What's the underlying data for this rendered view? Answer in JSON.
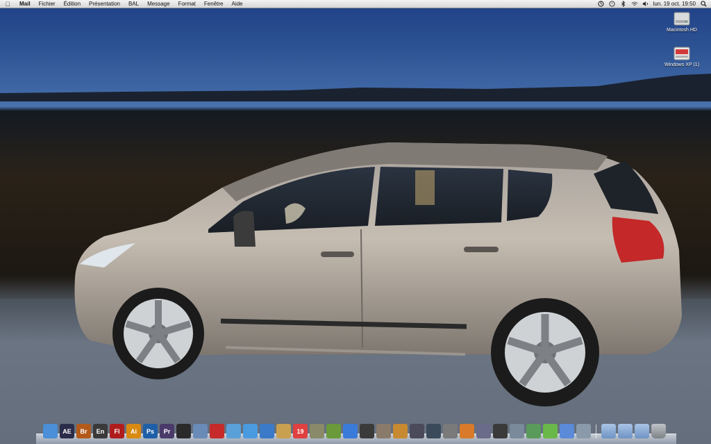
{
  "menubar": {
    "apple_icon": "apple-icon",
    "items": [
      "Mail",
      "Fichier",
      "Édition",
      "Présentation",
      "BAL",
      "Message",
      "Format",
      "Fenêtre",
      "Aide"
    ],
    "status_icons": [
      "sync-icon",
      "time-machine-icon",
      "bluetooth-icon",
      "wifi-icon",
      "volume-icon"
    ],
    "clock": "lun. 19 oct.  19:50"
  },
  "desktop": {
    "icons": [
      {
        "label": "Macintosh HD",
        "icon": "hard-drive-icon"
      },
      {
        "label": "Windows XP (1)",
        "icon": "windows-drive-icon"
      }
    ]
  },
  "dock": {
    "apps": [
      {
        "label": "",
        "icon": "finder-icon",
        "color": "#4a8fd8"
      },
      {
        "label": "AE",
        "icon": "after-effects-icon",
        "color": "#2b2b4a"
      },
      {
        "label": "Br",
        "icon": "bridge-icon",
        "color": "#b35a1a"
      },
      {
        "label": "En",
        "icon": "encore-icon",
        "color": "#3a3a3a"
      },
      {
        "label": "Fl",
        "icon": "flash-icon",
        "color": "#b01d1d"
      },
      {
        "label": "Ai",
        "icon": "illustrator-icon",
        "color": "#d98a12"
      },
      {
        "label": "Ps",
        "icon": "photoshop-icon",
        "color": "#1f5fa8"
      },
      {
        "label": "Pr",
        "icon": "premiere-icon",
        "color": "#4a3a6a"
      },
      {
        "label": "",
        "icon": "dashboard-icon",
        "color": "#2a2a2a"
      },
      {
        "label": "",
        "icon": "xcode-icon",
        "color": "#6a8ab8"
      },
      {
        "label": "",
        "icon": "magnet-icon",
        "color": "#c62a2a"
      },
      {
        "label": "",
        "icon": "safari-icon",
        "color": "#5aa0d8"
      },
      {
        "label": "",
        "icon": "ichat-icon",
        "color": "#4a9ae0"
      },
      {
        "label": "",
        "icon": "address-book-icon",
        "color": "#3a7ac8"
      },
      {
        "label": "",
        "icon": "stamp-icon",
        "color": "#c8a050"
      },
      {
        "label": "19",
        "icon": "ical-icon",
        "color": "#e04040"
      },
      {
        "label": "",
        "icon": "preview-icon",
        "color": "#8a8a6a"
      },
      {
        "label": "",
        "icon": "iphoto-icon",
        "color": "#6a9a3a"
      },
      {
        "label": "",
        "icon": "itunes-icon",
        "color": "#3a7ad8"
      },
      {
        "label": "",
        "icon": "camera-icon",
        "color": "#3a3a3a"
      },
      {
        "label": "",
        "icon": "imovie-star-icon",
        "color": "#8a7a6a"
      },
      {
        "label": "",
        "icon": "garageband-icon",
        "color": "#c88a30"
      },
      {
        "label": "",
        "icon": "spaces-icon",
        "color": "#4a4a5a"
      },
      {
        "label": "",
        "icon": "time-machine-icon",
        "color": "#3a4a5a"
      },
      {
        "label": "",
        "icon": "system-preferences-icon",
        "color": "#7a7a7a"
      },
      {
        "label": "",
        "icon": "keynote-icon",
        "color": "#d87a2a"
      },
      {
        "label": "",
        "icon": "photo-booth-icon",
        "color": "#6a6a8a"
      },
      {
        "label": "",
        "icon": "final-cut-icon",
        "color": "#3a3a3a"
      },
      {
        "label": "",
        "icon": "script-editor-icon",
        "color": "#7a8a9a"
      },
      {
        "label": "",
        "icon": "utility-icon",
        "color": "#5a9a5a"
      },
      {
        "label": "",
        "icon": "frog-icon",
        "color": "#6ab84a"
      },
      {
        "label": "",
        "icon": "sound-wave-icon",
        "color": "#5a8ad8"
      },
      {
        "label": "",
        "icon": "grid-app-icon",
        "color": "#8a9aaa"
      }
    ],
    "folders": [
      {
        "icon": "applications-folder-icon"
      },
      {
        "icon": "documents-folder-icon"
      },
      {
        "icon": "downloads-folder-icon"
      },
      {
        "icon": "trash-icon"
      }
    ]
  }
}
